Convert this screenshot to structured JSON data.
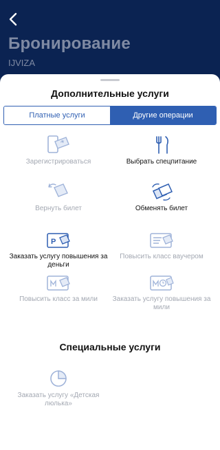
{
  "header": {
    "title": "Бронирование",
    "subtitle": "IJVIZA"
  },
  "sheet": {
    "title": "Дополнительные услуги",
    "tabs": [
      {
        "label": "Платные услуги",
        "active": false
      },
      {
        "label": "Другие операции",
        "active": true
      }
    ],
    "services": [
      {
        "label": "Зарегистрироваться",
        "icon": "phone-ticket-icon",
        "enabled": false
      },
      {
        "label": "Выбрать спецпитание",
        "icon": "fork-knife-icon",
        "enabled": true
      },
      {
        "label": "Вернуть билет",
        "icon": "return-ticket-icon",
        "enabled": false
      },
      {
        "label": "Обменять билет",
        "icon": "exchange-ticket-icon",
        "enabled": true
      },
      {
        "label": "Заказать услугу повышения за деньги",
        "icon": "paid-upgrade-icon",
        "enabled": true
      },
      {
        "label": "Повысить класс ваучером",
        "icon": "voucher-upgrade-icon",
        "enabled": false
      },
      {
        "label": "Повысить класс за мили",
        "icon": "miles-upgrade-icon",
        "enabled": false
      },
      {
        "label": "Заказать услугу повышения за мили",
        "icon": "miles-clock-upgrade-icon",
        "enabled": false
      }
    ],
    "special_title": "Специальные услуги",
    "special_services": [
      {
        "label": "Заказать услугу «Детская люлька»",
        "icon": "baby-cradle-icon",
        "enabled": false
      }
    ]
  },
  "colors": {
    "header_bg": "#0b2352",
    "accent": "#2f5fb2",
    "icon_disabled": "#9fb3d9",
    "text_disabled": "#a3a8b2"
  }
}
